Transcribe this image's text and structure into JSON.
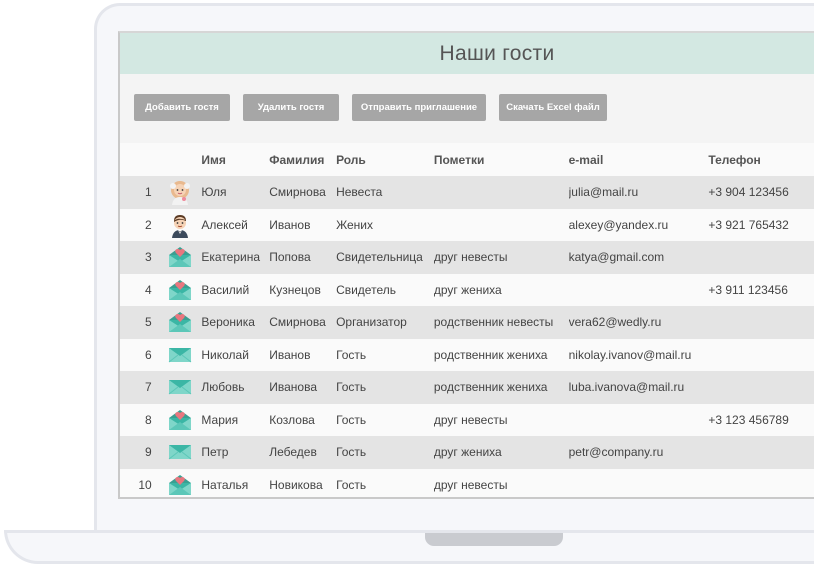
{
  "page": {
    "title": "Наши гости"
  },
  "toolbar": {
    "buttons": [
      {
        "label": "Добавить гостя"
      },
      {
        "label": "Удалить гостя"
      },
      {
        "label": "Отправить приглашение"
      },
      {
        "label": "Скачать Excel файл"
      }
    ]
  },
  "table": {
    "headers": {
      "first_name": "Имя",
      "last_name": "Фамилия",
      "role": "Роль",
      "notes": "Пометки",
      "email": "e-mail",
      "phone": "Телефон"
    },
    "rows": [
      {
        "num": "1",
        "avatar": "bride-avatar",
        "first_name": "Юля",
        "last_name": "Смирнова",
        "role": "Невеста",
        "notes": "",
        "email": "julia@mail.ru",
        "phone": "+3 904 123456"
      },
      {
        "num": "2",
        "avatar": "groom-avatar",
        "first_name": "Алексей",
        "last_name": "Иванов",
        "role": "Жених",
        "notes": "",
        "email": "alexey@yandex.ru",
        "phone": "+3 921 765432"
      },
      {
        "num": "3",
        "avatar": "open-envelope-icon",
        "first_name": "Екатерина",
        "last_name": "Попова",
        "role": "Свидетельница",
        "notes": "друг невесты",
        "email": "katya@gmail.com",
        "phone": ""
      },
      {
        "num": "4",
        "avatar": "open-envelope-icon",
        "first_name": "Василий",
        "last_name": "Кузнецов",
        "role": "Свидетель",
        "notes": "друг жениха",
        "email": "",
        "phone": "+3 911 123456"
      },
      {
        "num": "5",
        "avatar": "open-envelope-icon",
        "first_name": "Вероника",
        "last_name": "Смирнова",
        "role": "Организатор",
        "notes": "родственник невесты",
        "email": "vera62@wedly.ru",
        "phone": ""
      },
      {
        "num": "6",
        "avatar": "closed-envelope-icon",
        "first_name": "Николай",
        "last_name": "Иванов",
        "role": "Гость",
        "notes": "родственник жениха",
        "email": "nikolay.ivanov@mail.ru",
        "phone": ""
      },
      {
        "num": "7",
        "avatar": "closed-envelope-icon",
        "first_name": "Любовь",
        "last_name": "Иванова",
        "role": "Гость",
        "notes": "родственник жениха",
        "email": "luba.ivanova@mail.ru",
        "phone": ""
      },
      {
        "num": "8",
        "avatar": "open-envelope-icon",
        "first_name": "Мария",
        "last_name": "Козлова",
        "role": "Гость",
        "notes": "друг невесты",
        "email": "",
        "phone": "+3 123 456789"
      },
      {
        "num": "9",
        "avatar": "closed-envelope-icon",
        "first_name": "Петр",
        "last_name": "Лебедев",
        "role": "Гость",
        "notes": "друг жениха",
        "email": "petr@company.ru",
        "phone": ""
      },
      {
        "num": "10",
        "avatar": "open-envelope-icon",
        "first_name": "Наталья",
        "last_name": "Новикова",
        "role": "Гость",
        "notes": "друг невесты",
        "email": "",
        "phone": ""
      }
    ]
  },
  "colors": {
    "title_bar": "#d3e8e2",
    "button": "#a6a6a6",
    "envelope": "#3bb6a5",
    "heart": "#e8767f"
  }
}
